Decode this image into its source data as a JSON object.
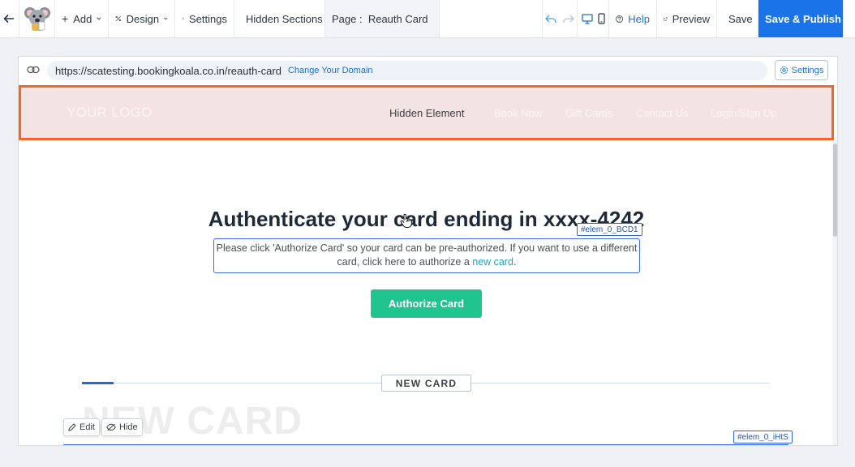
{
  "toolbar": {
    "add_label": "Add",
    "design_label": "Design",
    "settings_label": "Settings",
    "hidden_sections_label": "Hidden Sections",
    "page_prefix": "Page :",
    "page_name": "Reauth Card",
    "help_label": "Help",
    "preview_label": "Preview",
    "save_label": "Save",
    "publish_label": "Save & Publish"
  },
  "canvas": {
    "url": "https://scatesting.bookingkoala.co.in/reauth-card",
    "change_domain_label": "Change Your Domain",
    "settings_label": "Settings"
  },
  "site_header": {
    "logo_text": "YOUR LOGO",
    "nav": [
      "Hidden Element",
      "Book Now",
      "Gift Cards",
      "Contact Us",
      "Login/Sign Up"
    ]
  },
  "content": {
    "title": "Authenticate your card ending in xxxx-4242",
    "element_tag": "#elem_0_BCD1",
    "description_line1": "Please click 'Authorize Card' so your card can be pre-authorized. If you want to use a different",
    "description_line2_prefix": "card, click here to authorize a",
    "description_link": "new card",
    "description_line2_suffix": ".",
    "authorize_button": "Authorize Card",
    "section_chip": "NEW CARD",
    "ghost_heading": "NEW CARD",
    "edit_label": "Edit",
    "hide_label": "Hide",
    "element_tag_2": "#elem_0_iHtS"
  },
  "colors": {
    "primary": "#1a73e8",
    "header_selected_border": "#ea6a2a",
    "header_bg": "#f4e3e3",
    "authorize_button": "#1fc48f",
    "link": "#19a5c7"
  }
}
